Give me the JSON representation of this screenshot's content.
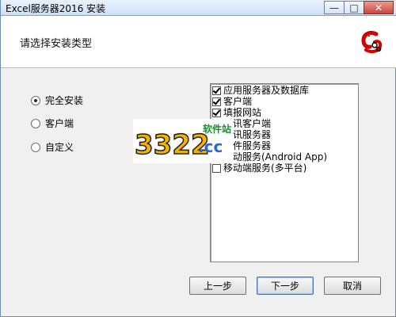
{
  "window": {
    "title": "Excel服务器2016 安装",
    "caption": {
      "minimize": "—",
      "maximize": "□",
      "close": "✕"
    }
  },
  "header": {
    "title": "请选择安装类型"
  },
  "install_types": [
    {
      "label": "完全安装",
      "selected": true
    },
    {
      "label": "客户端",
      "selected": false
    },
    {
      "label": "自定义",
      "selected": false
    }
  ],
  "components": [
    {
      "label": "应用服务器及数据库",
      "checked": true
    },
    {
      "label": "客户端",
      "checked": true
    },
    {
      "label": "填报网站",
      "checked": true
    },
    {
      "label": "通讯客户端",
      "checked": true
    },
    {
      "label": "通讯服务器",
      "checked": true
    },
    {
      "label": "文件服务器",
      "checked": true
    },
    {
      "label": "移动服务(Android App)",
      "checked": true
    },
    {
      "label": "移动端服务(多平台)",
      "checked": false
    }
  ],
  "watermark": {
    "number": "3322",
    "tld": ".cc",
    "tag": "软件站"
  },
  "buttons": {
    "back": "上一步",
    "next": "下一步",
    "cancel": "取消"
  },
  "colors": {
    "title_bar": "#cfe1f7",
    "close_button": "#c5473b",
    "logo_red": "#d40000"
  }
}
